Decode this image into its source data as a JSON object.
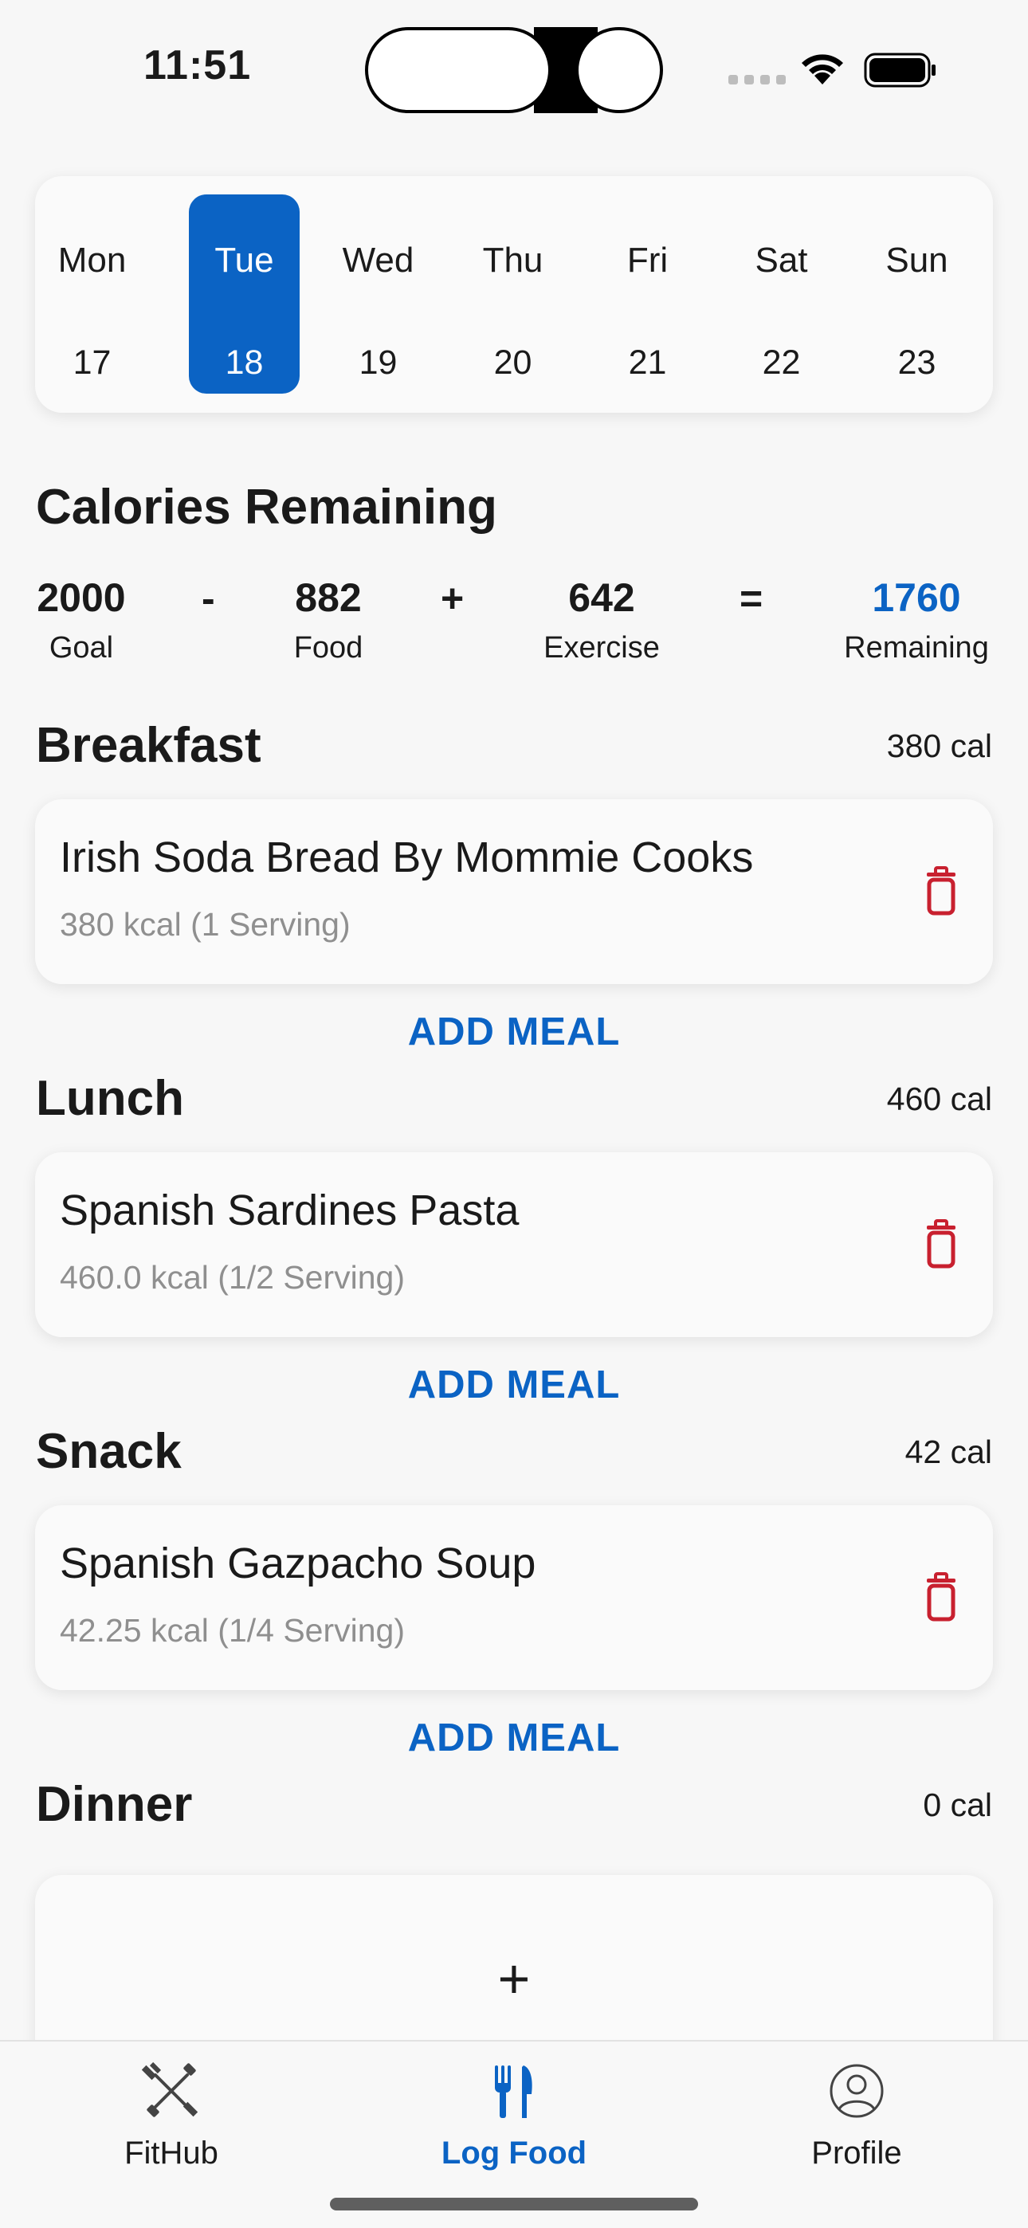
{
  "status_bar": {
    "time": "11:51"
  },
  "week": {
    "days": [
      {
        "name": "Mon",
        "date": "17",
        "selected": false
      },
      {
        "name": "Tue",
        "date": "18",
        "selected": true
      },
      {
        "name": "Wed",
        "date": "19",
        "selected": false
      },
      {
        "name": "Thu",
        "date": "20",
        "selected": false
      },
      {
        "name": "Fri",
        "date": "21",
        "selected": false
      },
      {
        "name": "Sat",
        "date": "22",
        "selected": false
      },
      {
        "name": "Sun",
        "date": "23",
        "selected": false
      }
    ]
  },
  "calories": {
    "title": "Calories Remaining",
    "goal": {
      "value": "2000",
      "label": "Goal"
    },
    "op1": "-",
    "food": {
      "value": "882",
      "label": "Food"
    },
    "op2": "+",
    "exercise": {
      "value": "642",
      "label": "Exercise"
    },
    "op3": "=",
    "remaining": {
      "value": "1760",
      "label": "Remaining"
    }
  },
  "meals": [
    {
      "title": "Breakfast",
      "calories": "380 cal",
      "items": [
        {
          "name": "Irish Soda Bread By Mommie Cooks",
          "detail": "380 kcal (1 Serving)"
        }
      ],
      "add_label": "ADD MEAL"
    },
    {
      "title": "Lunch",
      "calories": "460 cal",
      "items": [
        {
          "name": "Spanish Sardines Pasta",
          "detail": "460.0 kcal (1/2 Serving)"
        }
      ],
      "add_label": "ADD MEAL"
    },
    {
      "title": "Snack",
      "calories": "42 cal",
      "items": [
        {
          "name": "Spanish Gazpacho Soup",
          "detail": "42.25 kcal (1/4 Serving)"
        }
      ],
      "add_label": "ADD MEAL"
    },
    {
      "title": "Dinner",
      "calories": "0 cal",
      "items": [],
      "add_symbol": "+"
    }
  ],
  "tabs": [
    {
      "label": "FitHub",
      "icon": "fithub-icon",
      "active": false
    },
    {
      "label": "Log Food",
      "icon": "utensils-icon",
      "active": true
    },
    {
      "label": "Profile",
      "icon": "profile-icon",
      "active": false
    }
  ],
  "colors": {
    "accent": "#0b63c4",
    "delete": "#c8202f",
    "muted": "#8f8f8f"
  }
}
